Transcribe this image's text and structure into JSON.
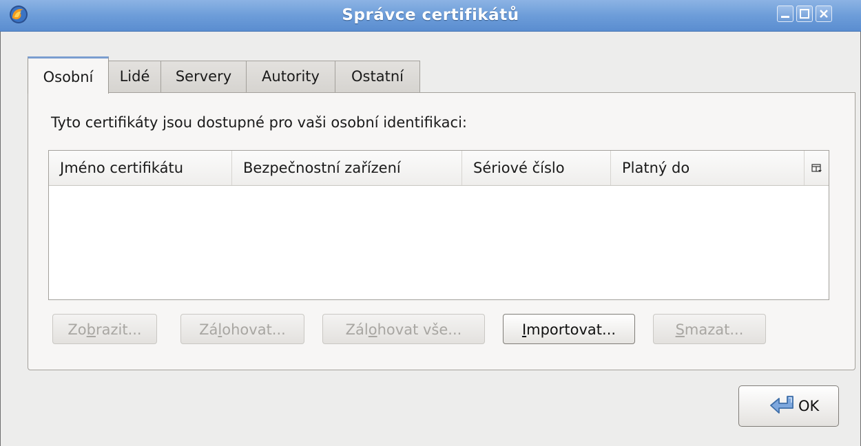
{
  "window": {
    "title": "Správce certifikátů"
  },
  "tabs": [
    {
      "label": "Osobní",
      "active": true
    },
    {
      "label": "Lidé",
      "active": false
    },
    {
      "label": "Servery",
      "active": false
    },
    {
      "label": "Autority",
      "active": false
    },
    {
      "label": "Ostatní",
      "active": false
    }
  ],
  "panel": {
    "description": "Tyto certifikáty jsou dostupné pro vaši osobní identifikaci:",
    "columns": [
      "Jméno certifikátu",
      "Bezpečnostní zařízení",
      "Sériové číslo",
      "Platný do"
    ],
    "rows": []
  },
  "buttons": {
    "view": {
      "pre": "Zo",
      "key": "b",
      "post": "razit...",
      "enabled": false
    },
    "backup": {
      "pre": "Zá",
      "key": "l",
      "post": "ohovat...",
      "enabled": false
    },
    "backup_all": {
      "pre": "Zál",
      "key": "o",
      "post": "hovat vše...",
      "enabled": false
    },
    "import": {
      "pre": "",
      "key": "I",
      "post": "mportovat...",
      "enabled": true
    },
    "delete": {
      "pre": "",
      "key": "S",
      "post": "mazat...",
      "enabled": false
    }
  },
  "dialog": {
    "ok_label": "OK"
  },
  "icons": {
    "app": "firefox-icon",
    "column_picker": "column-picker-icon",
    "ok": "return-arrow-icon"
  },
  "colors": {
    "titlebar": "#6d9dd9",
    "active_tab_accent": "#7a9dcf",
    "disabled_text": "#a8a6a2"
  }
}
